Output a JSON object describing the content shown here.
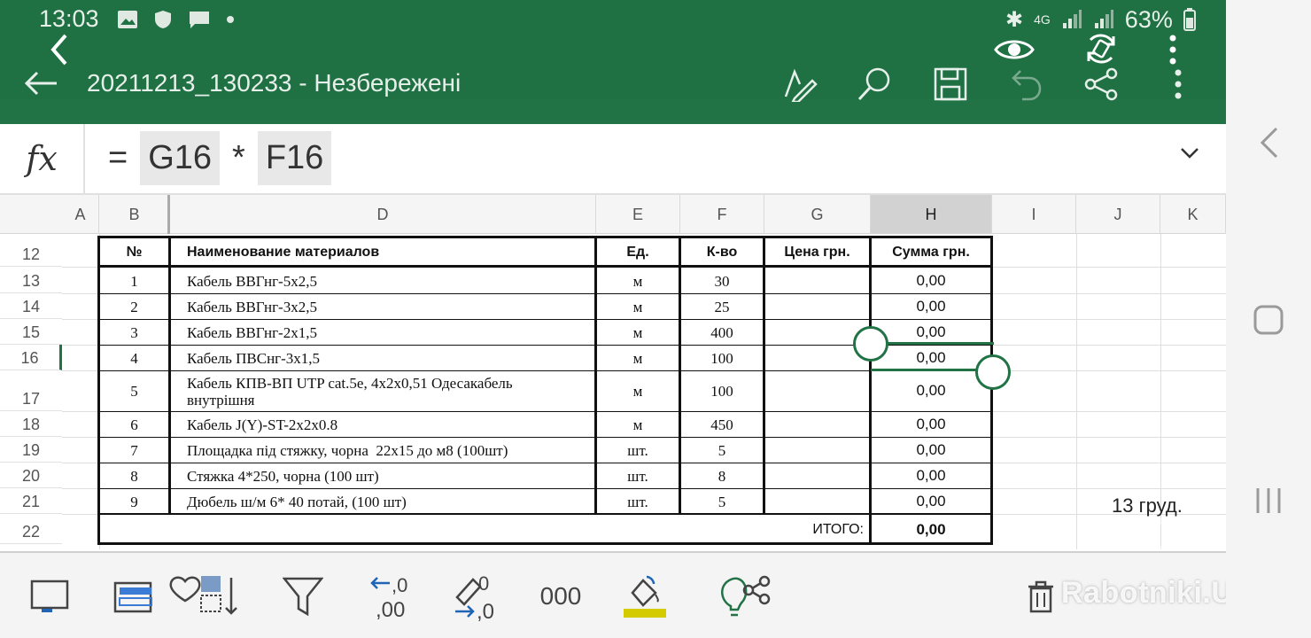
{
  "status_bar": {
    "time": "13:03",
    "battery": "63%",
    "network": "4G"
  },
  "app": {
    "title": "20211213_130233 - Незбережені",
    "accent": "#217346"
  },
  "formula_bar": {
    "fx_label": "fx",
    "equals": "=",
    "ref1": "G16",
    "operator": "*",
    "ref2": "F16"
  },
  "columns": [
    "A",
    "B",
    "D",
    "E",
    "F",
    "G",
    "H",
    "I",
    "J",
    "K"
  ],
  "selected_column": "H",
  "rows": [
    {
      "num": "12"
    },
    {
      "num": "13"
    },
    {
      "num": "14"
    },
    {
      "num": "15"
    },
    {
      "num": "16"
    },
    {
      "num": "17"
    },
    {
      "num": "18"
    },
    {
      "num": "19"
    },
    {
      "num": "20"
    },
    {
      "num": "21"
    },
    {
      "num": "22"
    }
  ],
  "table": {
    "headers": {
      "no": "№",
      "name": "Наименование материалов",
      "unit": "Ед.",
      "qty": "К-во",
      "price": "Цена грн.",
      "sum": "Сумма грн."
    },
    "items": [
      {
        "no": "1",
        "name": "Кабель ВВГнг-5х2,5",
        "unit": "м",
        "qty": "30",
        "sum": "0,00"
      },
      {
        "no": "2",
        "name": "Кабель ВВГнг-3х2,5",
        "unit": "м",
        "qty": "25",
        "sum": "0,00"
      },
      {
        "no": "3",
        "name": "Кабель ВВГнг-2х1,5",
        "unit": "м",
        "qty": "400",
        "sum": "0,00"
      },
      {
        "no": "4",
        "name": "Кабель ПВСнг-3х1,5",
        "unit": "м",
        "qty": "100",
        "sum": "0,00"
      },
      {
        "no": "5",
        "name_line1": "Кабель КПВ-ВП UTP cat.5e, 4х2х0,51 Одесакабель",
        "name_line2": "внутрішня",
        "unit": "м",
        "qty": "100",
        "sum": "0,00"
      },
      {
        "no": "6",
        "name": "Кабель J(Y)-ST-2х2х0.8",
        "unit": "м",
        "qty": "450",
        "sum": "0,00"
      },
      {
        "no": "7",
        "name": "Площадка під стяжку, чорна  22х15 до м8 (100шт)",
        "unit": "шт.",
        "qty": "5",
        "sum": "0,00"
      },
      {
        "no": "8",
        "name": "Стяжка 4*250, чорна (100 шт)",
        "unit": "шт.",
        "qty": "8",
        "sum": "0,00"
      },
      {
        "no": "9",
        "name": "Дюбель ш/м 6* 40 потай, (100 шт)",
        "unit": "шт.",
        "qty": "5",
        "sum": "0,00"
      }
    ],
    "total_label": "ИТОГО:",
    "total_value": "0,00"
  },
  "side_note": "13 груд.",
  "toolbar": {
    "decimal_increase": ",0\n,00",
    "decimal_decrease": ",0\n,0",
    "thousands": "000",
    "fill_color": "#d4cc00"
  },
  "watermark": "Rabotniki.UA"
}
